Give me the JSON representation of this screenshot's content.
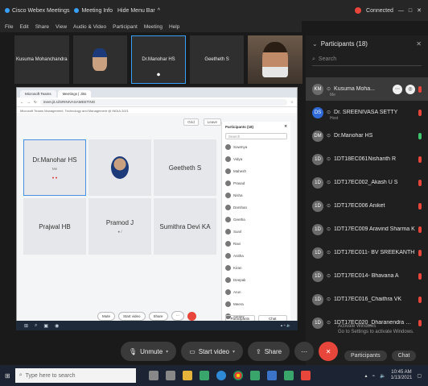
{
  "titlebar": {
    "title": "Cisco Webex Meetings",
    "meeting_info": "Meeting Info",
    "hide_menu": "Hide Menu Bar",
    "connected": "Connected"
  },
  "menubar": [
    "File",
    "Edit",
    "Share",
    "View",
    "Audio & Video",
    "Participant",
    "Meeting",
    "Help"
  ],
  "video_strip": [
    {
      "label": "Kusuma Mohanchandra",
      "type": "name"
    },
    {
      "label": "",
      "type": "face"
    },
    {
      "label": "Dr.Manohar HS",
      "type": "name",
      "active": true
    },
    {
      "label": "Geetheth S",
      "type": "name"
    },
    {
      "label": "",
      "type": "camera"
    }
  ],
  "shared_screen": {
    "tabs": [
      "Microsoft Teams",
      "Meetings | Jitsi"
    ],
    "url": "meet.jit.si/SRINIVASAMEETING",
    "bookmarks": "Microsoft Teams Management, Technology and Management  @ INDIA 2021",
    "top_buttons": [
      "Grid",
      "Leave"
    ],
    "tiles": [
      {
        "name": "Dr.Manohar HS",
        "sub": "Me",
        "status": "● ●",
        "active": true
      },
      {
        "name": "",
        "avatar": true
      },
      {
        "name": "Geetheth S"
      },
      {
        "name": "Prajwal HB"
      },
      {
        "name": "Pramod J",
        "sub": "● /"
      },
      {
        "name": "Sumithra Devi KA"
      }
    ],
    "panel": {
      "title": "Participants (18)",
      "search": "Search",
      "rows": [
        "Sowmya",
        "Vidya",
        "Mahesh",
        "Prasad",
        "Nisha",
        "Darshan",
        "Geetha",
        "Sunil",
        "Ravi",
        "Anitha",
        "Kiran",
        "Deepak",
        "Arun",
        "Meera",
        "Sanjay",
        "Harsha"
      ],
      "footer": [
        "Participants",
        "Chat"
      ]
    },
    "controls": [
      "Mute",
      "Start video",
      "Share",
      "⋯"
    ]
  },
  "sidebar": {
    "title": "Participants (18)",
    "search_placeholder": "Search",
    "participants": [
      {
        "badge": "KM",
        "name": "Kusuma Moha...",
        "meta": "Me",
        "mic": "red",
        "highlight": true,
        "hover": true
      },
      {
        "badge": "DS",
        "name": "Dr. SREENIVASA SETTY",
        "meta": "Host",
        "mic": "red",
        "blue": true
      },
      {
        "badge": "DM",
        "name": "Dr.Manohar HS",
        "mic": "green"
      },
      {
        "badge": "1D",
        "name": "1DT18EC061Nishanth R",
        "mic": "red"
      },
      {
        "badge": "1D",
        "name": "1DT17EC002_Akash U S",
        "mic": "red"
      },
      {
        "badge": "1D",
        "name": "1DT17EC006 Aniket",
        "mic": "red"
      },
      {
        "badge": "1D",
        "name": "1DT17EC009 Aravind Sharma K",
        "mic": "red"
      },
      {
        "badge": "1D",
        "name": "1DT17EC011- BV SREEKANTH",
        "mic": "red"
      },
      {
        "badge": "1D",
        "name": "1DT17EC014- Bhavana A",
        "mic": "red"
      },
      {
        "badge": "1D",
        "name": "1DT17EC016_Chaithra VK",
        "mic": "red"
      },
      {
        "badge": "1D",
        "name": "1DT17EC020_Dharanendra Gow...",
        "mic": "red"
      }
    ],
    "foot": [
      "Participants",
      "Chat"
    ],
    "watermark_line1": "Activate Windows",
    "watermark_line2": "Go to Settings to activate Windows."
  },
  "controls": {
    "mute": "Unmute",
    "video": "Start video",
    "share": "Share",
    "more": "⋯",
    "end": "✕"
  },
  "win_taskbar": {
    "search_placeholder": "Type here to search",
    "time": "10:45 AM",
    "date": "1/13/2021"
  }
}
